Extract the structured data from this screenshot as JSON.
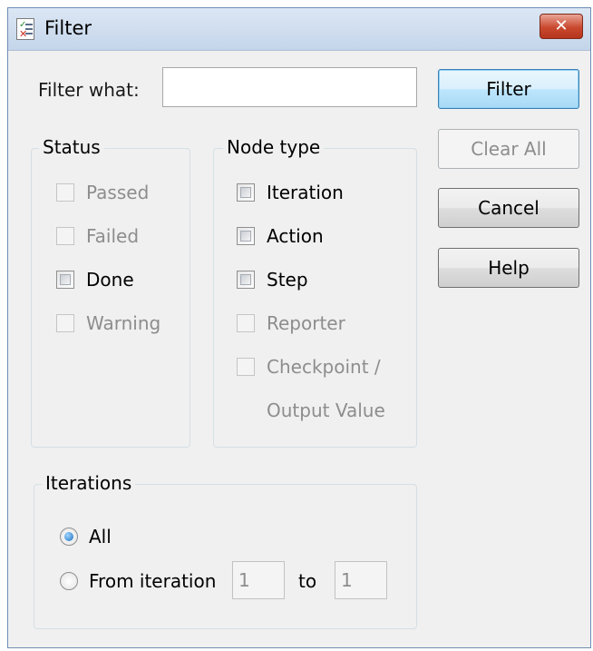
{
  "window": {
    "title": "Filter"
  },
  "filter_what": {
    "label": "Filter what:",
    "value": ""
  },
  "buttons": {
    "filter": "Filter",
    "clear_all": "Clear All",
    "cancel": "Cancel",
    "help": "Help",
    "close": "✕"
  },
  "status": {
    "legend": "Status",
    "items": [
      {
        "label": "Passed",
        "checked": false,
        "enabled": false
      },
      {
        "label": "Failed",
        "checked": false,
        "enabled": false
      },
      {
        "label": "Done",
        "checked": false,
        "enabled": true
      },
      {
        "label": "Warning",
        "checked": false,
        "enabled": false
      }
    ]
  },
  "node_type": {
    "legend": "Node type",
    "items": [
      {
        "label": "Iteration",
        "checked": false,
        "enabled": true
      },
      {
        "label": "Action",
        "checked": false,
        "enabled": true
      },
      {
        "label": "Step",
        "checked": false,
        "enabled": true
      },
      {
        "label": "Reporter",
        "checked": false,
        "enabled": false
      },
      {
        "label": "Checkpoint /",
        "checked": false,
        "enabled": false
      }
    ],
    "wrap_label": "Output Value"
  },
  "iterations": {
    "legend": "Iterations",
    "all_label": "All",
    "from_label": "From iteration",
    "to_label": "to",
    "from_value": "1",
    "to_value": "1",
    "selected": "All"
  },
  "colors": {
    "title_bar": "#c4d5ea",
    "close_button": "#c9492f",
    "default_button_border": "#3c7fb1",
    "disabled_text": "#8d8d8d"
  }
}
